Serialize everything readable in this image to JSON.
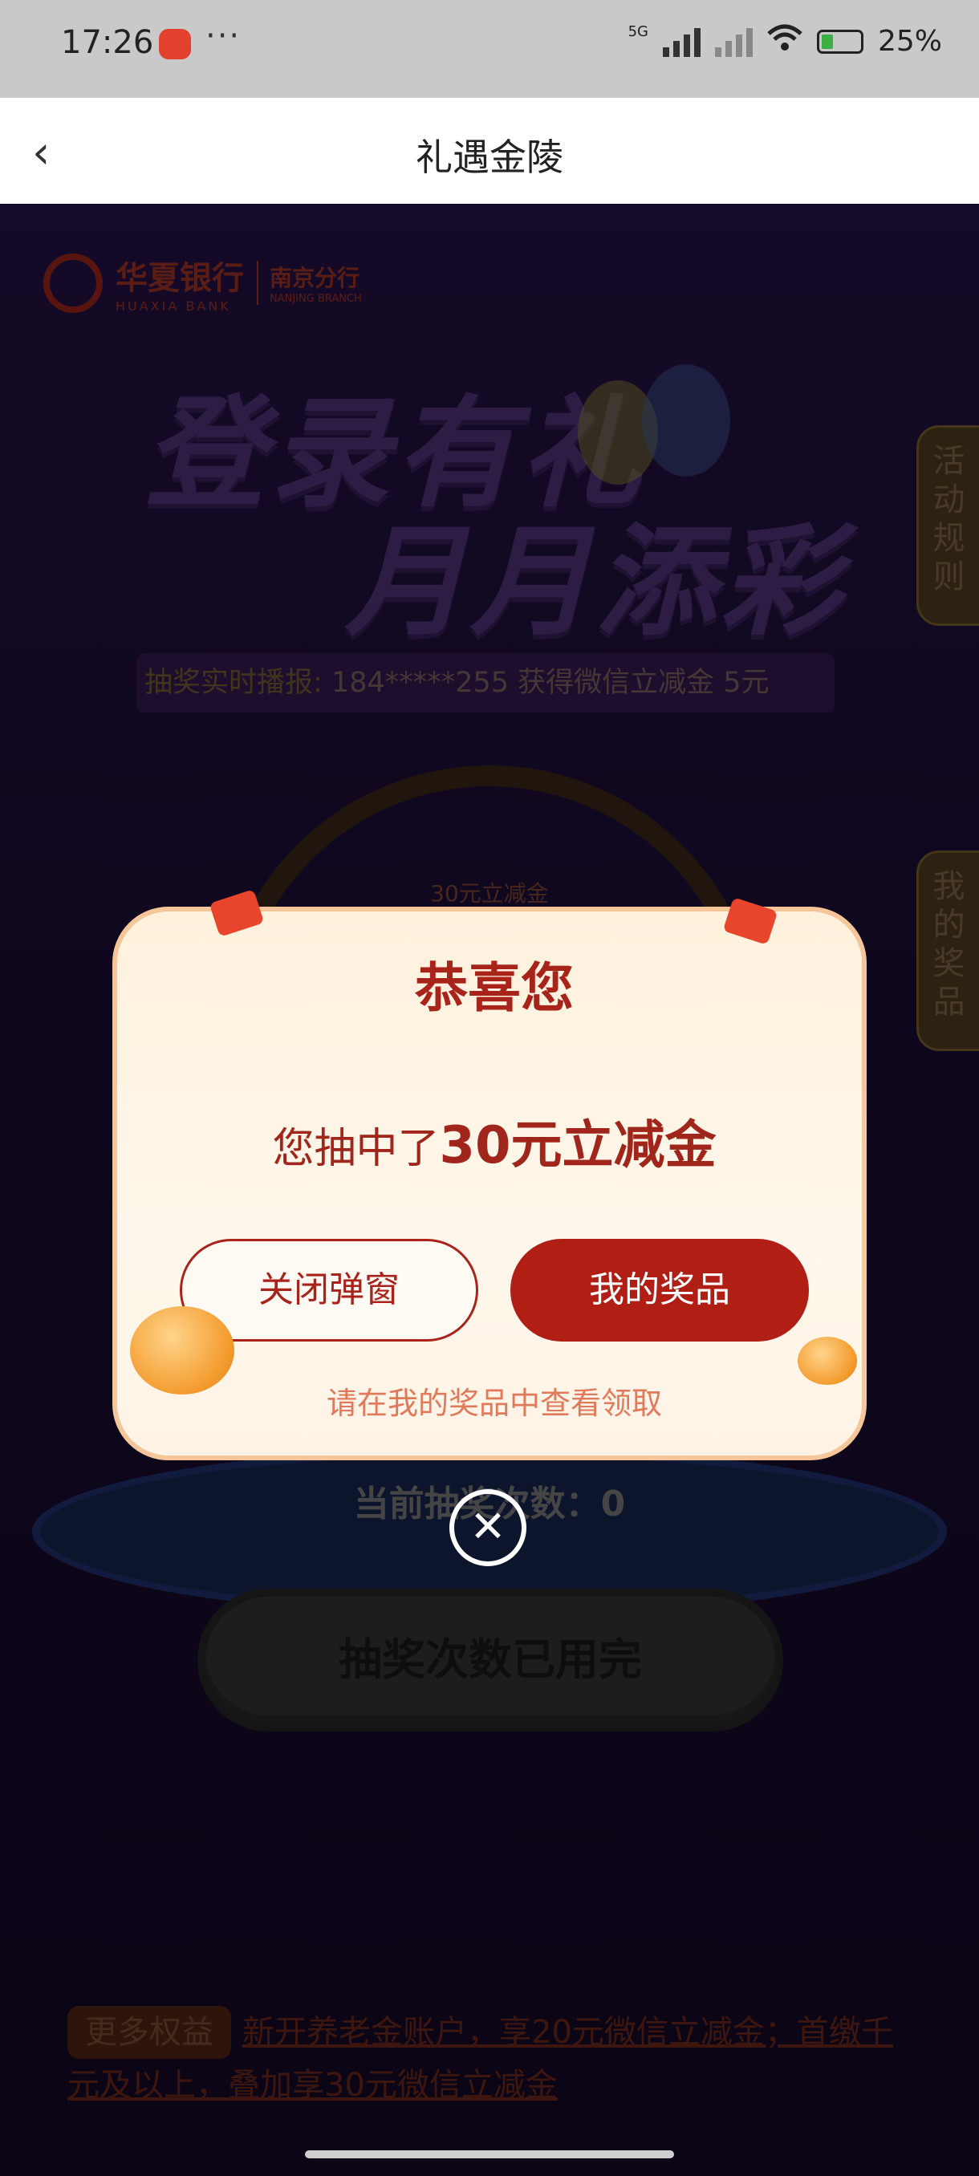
{
  "status_bar": {
    "time": "17:26",
    "more": "···",
    "network": "5G",
    "battery": "25%"
  },
  "nav": {
    "back_icon": "chevron-left-icon",
    "title": "礼遇金陵"
  },
  "banner": {
    "bank_name": "华夏银行",
    "bank_name_en": "HUAXIA BANK",
    "branch": "南京分行",
    "branch_en": "NANJING BRANCH",
    "headline_1": "登录有礼",
    "headline_2": "月月添彩"
  },
  "ticker": {
    "label": "抽奖实时播报:",
    "text": "184*****255 获得微信立减金 5元"
  },
  "side_tabs": {
    "rules": "活动规则",
    "my_prizes": "我的奖品"
  },
  "wheel": {
    "slot_label": "30元立减金"
  },
  "draw": {
    "count_text": "当前抽奖次数：0",
    "button_label": "抽奖次数已用完"
  },
  "more_benefits": {
    "badge": "更多权益",
    "link_text": "新开养老金账户，享20元微信立减金；首缴千元及以上，叠加享30元微信立减金"
  },
  "dialog": {
    "title": "恭喜您",
    "prize_prefix": "您抽中了",
    "prize_name": "30元立减金",
    "close_label": "关闭弹窗",
    "prizes_label": "我的奖品",
    "hint": "请在我的奖品中查看领取",
    "dismiss_icon": "close-circle-icon"
  },
  "colors": {
    "accent": "#b01e14",
    "dialog_bg": "#fff3e6",
    "overlay": "#000000"
  }
}
